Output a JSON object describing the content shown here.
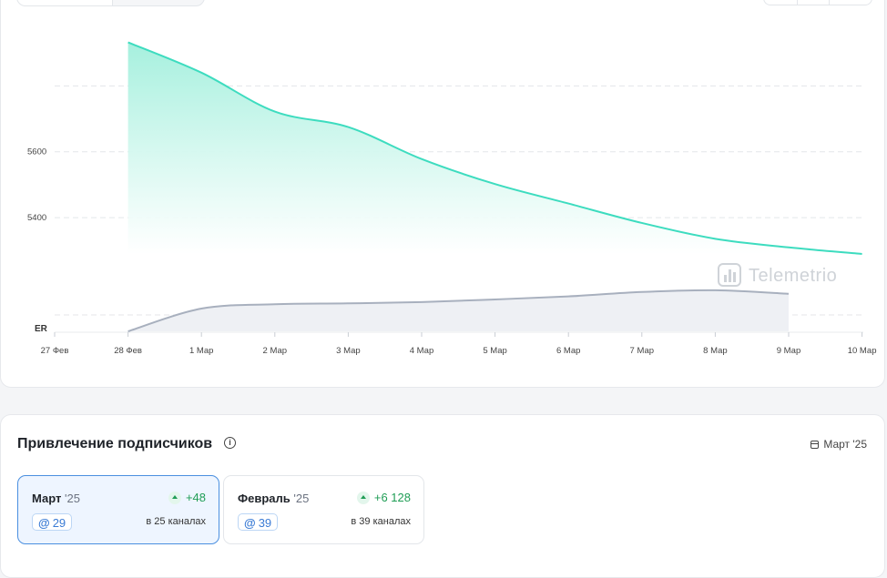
{
  "colors": {
    "subscribers_line": "#3ddcbf",
    "subscribers_fill_top": "#a6f0de",
    "er_line": "#a8b0be",
    "er_fill": "#eef0f4",
    "grid": "#e4e6ea",
    "active_border": "#4a8fe0",
    "positive": "#1f9d55"
  },
  "chart_data": {
    "type": "area",
    "x": [
      "27 Фев",
      "28 Фев",
      "1 Мар",
      "2 Мар",
      "3 Мар",
      "4 Мар",
      "5 Мар",
      "6 Мар",
      "7 Мар",
      "8 Мар",
      "9 Мар",
      "10 Мар"
    ],
    "ytick_labels": [
      "5600",
      "5400"
    ],
    "ytick_values": [
      5600,
      5400
    ],
    "ylim": [
      5290,
      5950
    ],
    "grid": true,
    "series": [
      {
        "values": [
          null,
          5932,
          5840,
          5722,
          5675,
          5578,
          5502,
          5443,
          5384,
          5336,
          5310,
          5290
        ]
      }
    ],
    "secondary": {
      "label": "ER",
      "values": [
        null,
        0,
        0.52,
        0.62,
        0.64,
        0.67,
        0.73,
        0.8,
        0.9,
        0.94,
        0.86,
        null
      ],
      "ylim": [
        0,
        1
      ]
    }
  },
  "watermark": "Telemetrio",
  "subs": {
    "title": "Привлечение подписчиков",
    "info_icon": "info-icon",
    "period_icon": "calendar-icon",
    "period": "Март '25",
    "months": [
      {
        "name": "Март",
        "year": "'25",
        "delta": "+48",
        "mentions": "29",
        "channels": "в 25 каналах"
      },
      {
        "name": "Февраль",
        "year": "'25",
        "delta": "+6 128",
        "mentions": "39",
        "channels": "в 39 каналах"
      }
    ]
  }
}
